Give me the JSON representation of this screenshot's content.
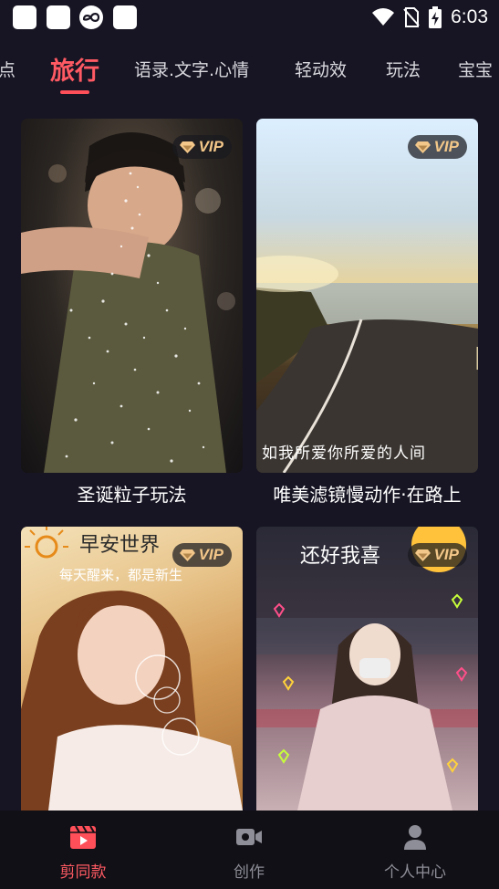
{
  "status_bar": {
    "time": "6:03",
    "notification_icons": [
      "app-square-icon",
      "app-square-icon",
      "infinity-app-icon",
      "app-square-icon"
    ],
    "system_icons": [
      "wifi-icon",
      "no-sim-icon",
      "battery-charging-icon"
    ]
  },
  "tabs": [
    {
      "label": "点",
      "active": false
    },
    {
      "label": "旅行",
      "active": true
    },
    {
      "label": "语录.文字.心情",
      "active": false
    },
    {
      "label": "轻动效",
      "active": false
    },
    {
      "label": "玩法",
      "active": false
    },
    {
      "label": "宝宝",
      "active": false
    }
  ],
  "accent_color": "#ff5a63",
  "vip_label": "VIP",
  "templates": [
    {
      "title": "圣诞粒子玩法",
      "vip": true
    },
    {
      "title": "唯美滤镜慢动作·在路上",
      "vip": true,
      "overlay_text": "如我所爱你所爱的人间"
    },
    {
      "title": "",
      "vip": true,
      "overlay_text_1": "早安世界",
      "overlay_text_2": "每天醒来，都是新生"
    },
    {
      "title": "",
      "vip": true,
      "overlay_text": "还好我喜"
    }
  ],
  "bottom_nav": [
    {
      "label": "剪同款",
      "icon": "clapperboard-icon",
      "active": true
    },
    {
      "label": "创作",
      "icon": "video-camera-icon",
      "active": false
    },
    {
      "label": "个人中心",
      "icon": "person-icon",
      "active": false
    }
  ]
}
